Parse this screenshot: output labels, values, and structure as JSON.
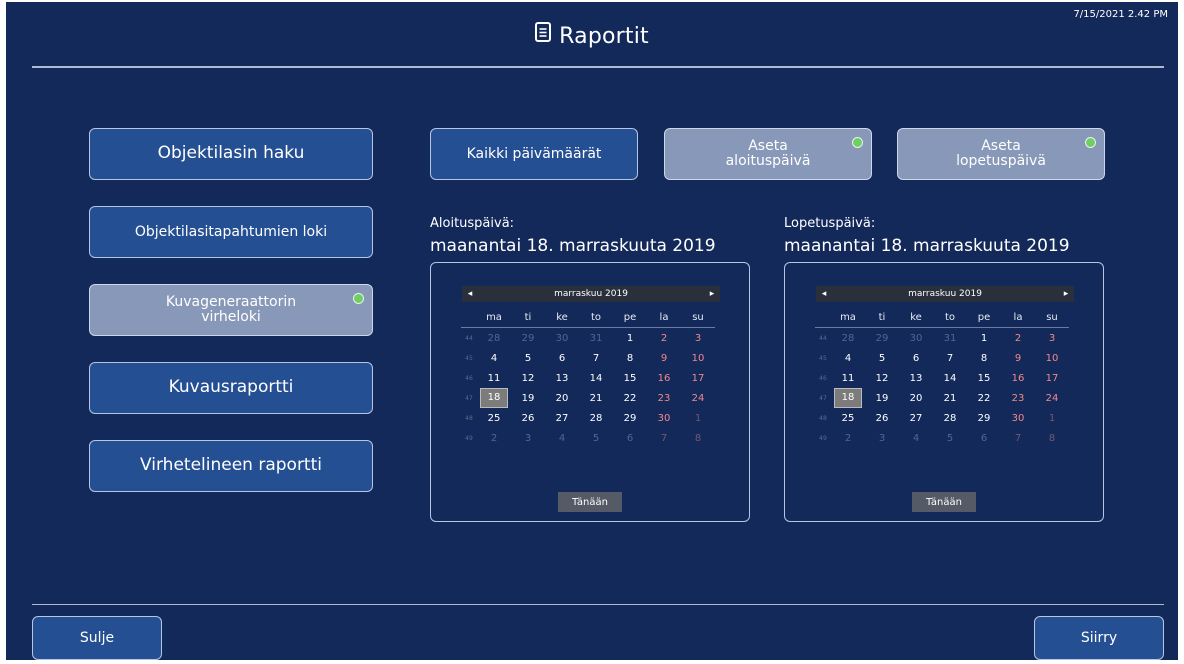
{
  "header": {
    "title": "Raportit",
    "clock": "7/15/2021 2.42 PM",
    "title_icon": "document-icon"
  },
  "sidebar": [
    {
      "label": "Objektilasin haku",
      "active": false
    },
    {
      "label": "Objektilasitapahtumien loki",
      "active": false
    },
    {
      "label": "Kuvageneraattorin virheloki",
      "active": true
    },
    {
      "label": "Kuvausraportti",
      "active": false
    },
    {
      "label": "Virhetelineen raportti",
      "active": false
    }
  ],
  "date_buttons": {
    "all_dates": "Kaikki päivämäärät",
    "set_start": "Aseta aloituspäivä",
    "set_end": "Aseta lopetuspäivä"
  },
  "start": {
    "label": "Aloituspäivä:",
    "value": "maanantai 18. marraskuuta 2019"
  },
  "end": {
    "label": "Lopetuspäivä:",
    "value": "maanantai 18. marraskuuta 2019"
  },
  "calendar": {
    "month_label": "marraskuu 2019",
    "prev_glyph": "◂",
    "next_glyph": "▸",
    "weekdays": [
      "ma",
      "ti",
      "ke",
      "to",
      "pe",
      "la",
      "su"
    ],
    "weeks": [
      {
        "num": "44",
        "days": [
          "28",
          "29",
          "30",
          "31",
          "1",
          "2",
          "3"
        ]
      },
      {
        "num": "45",
        "days": [
          "4",
          "5",
          "6",
          "7",
          "8",
          "9",
          "10"
        ]
      },
      {
        "num": "46",
        "days": [
          "11",
          "12",
          "13",
          "14",
          "15",
          "16",
          "17"
        ]
      },
      {
        "num": "47",
        "days": [
          "18",
          "19",
          "20",
          "21",
          "22",
          "23",
          "24"
        ]
      },
      {
        "num": "48",
        "days": [
          "25",
          "26",
          "27",
          "28",
          "29",
          "30",
          "1"
        ]
      },
      {
        "num": "49",
        "days": [
          "2",
          "3",
          "4",
          "5",
          "6",
          "7",
          "8"
        ]
      }
    ],
    "selected_day": "18",
    "today_label": "Tänään"
  },
  "footer": {
    "close": "Sulje",
    "go": "Siirry"
  },
  "colors": {
    "background": "#13295a",
    "button": "#254f93",
    "selected": "#8898b8",
    "indicator": "#6fcf66",
    "weekend": "#f08a8a"
  }
}
